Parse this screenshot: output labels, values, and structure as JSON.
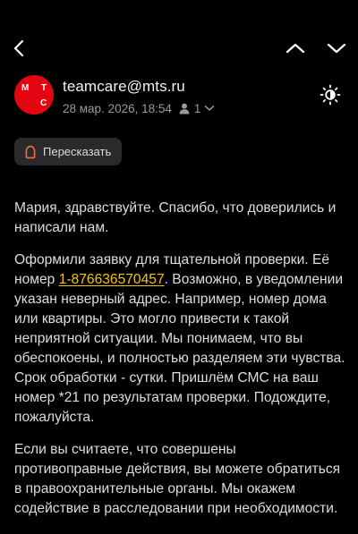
{
  "toolbar": {
    "back": "back",
    "prev": "previous-message",
    "next": "next-message",
    "theme": "brightness"
  },
  "sender": {
    "avatar_letters": [
      "М",
      "Т",
      "С"
    ],
    "email": "teamcare@mts.ru",
    "date": "28 мар. 2026, 18:54",
    "recipients_count": "1",
    "avatar_color": "#e30611"
  },
  "retell_button": {
    "label": "Пересказать"
  },
  "message": {
    "p1": "Мария, здравствуйте. Спасибо, что доверились и написали нам.",
    "p2_before": "Оформили заявку для тщательной проверки. Её номер ",
    "p2_link": "1-876636570457",
    "p2_after": ". Возможно, в уведомлении указан неверный адрес. Например, номер дома или квартиры. Это могло привести к такой неприятной ситуации. Мы понимаем, что вы обеспокоены, и полностью разделяем эти чувства. Срок обработки - сутки. Пришлём СМС на ваш номер *21 по результатам проверки. Подождите, пожалуйста.",
    "p3": "Если вы считаете, что совершены противоправные действия, вы можете обратиться в правоохранительные органы. Мы окажем содействие в расследовании при необходимости.",
    "link_color": "#f2c500"
  }
}
